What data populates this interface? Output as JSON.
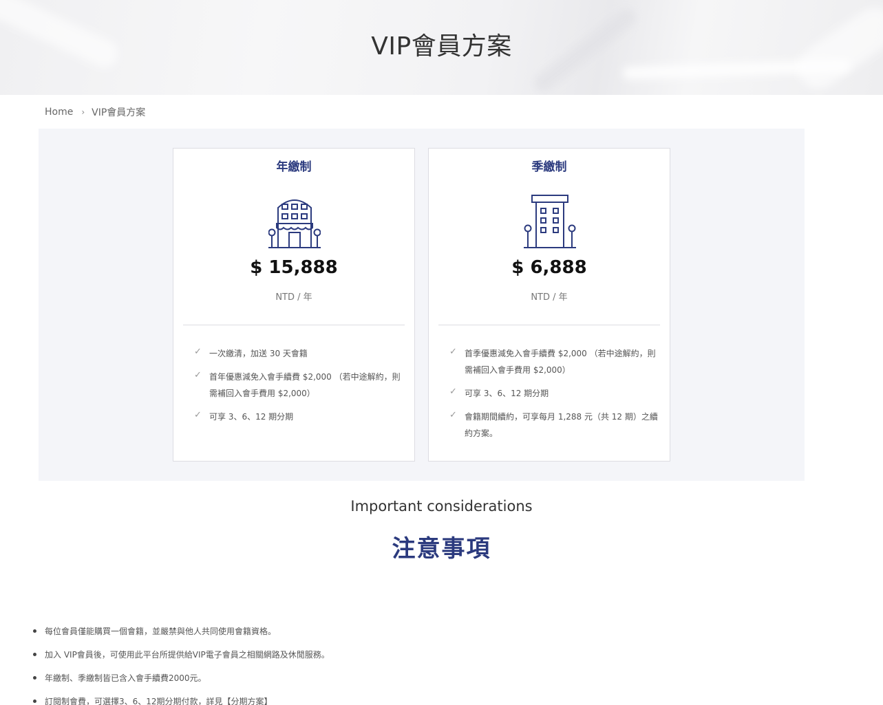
{
  "hero": {
    "title": "VIP會員方案"
  },
  "breadcrumb": {
    "home": "Home",
    "separator": "›",
    "current": "VIP會員方案"
  },
  "plans": [
    {
      "title": "年繳制",
      "icon": "storefront-building-icon",
      "price": "$ 15,888",
      "unit": "NTD / 年",
      "features": [
        "一次繳清，加送 30 天會籍",
        "首年優惠減免入會手續費 $2,000 （若中途解約，則需補回入會手費用 $2,000）",
        "可享 3、6、12 期分期"
      ]
    },
    {
      "title": "季繳制",
      "icon": "office-building-icon",
      "price": "$ 6,888",
      "unit": "NTD / 年",
      "features": [
        "首季優惠減免入會手續費 $2,000 （若中途解約，則需補回入會手費用 $2,000）",
        "可享 3、6、12 期分期",
        "會籍期間續約，可享每月 1,288 元（共 12 期）之續約方案。"
      ]
    }
  ],
  "considerations": {
    "heading_en": "Important considerations",
    "heading_zh": "注意事項",
    "items": [
      "每位會員僅能購買一個會籍，並嚴禁與他人共同使用會籍資格。",
      "加入 VIP會員後，可使用此平台所提供給VIP電子會員之相關網路及休閒服務。",
      "年繳制、季繳制皆已含入會手續費2000元。",
      "訂閱制會費，可選擇3、6、12期分期付款，詳見【分期方案】"
    ]
  },
  "colors": {
    "accent": "#2b3a7e",
    "panel_bg": "#f4f5f9"
  }
}
